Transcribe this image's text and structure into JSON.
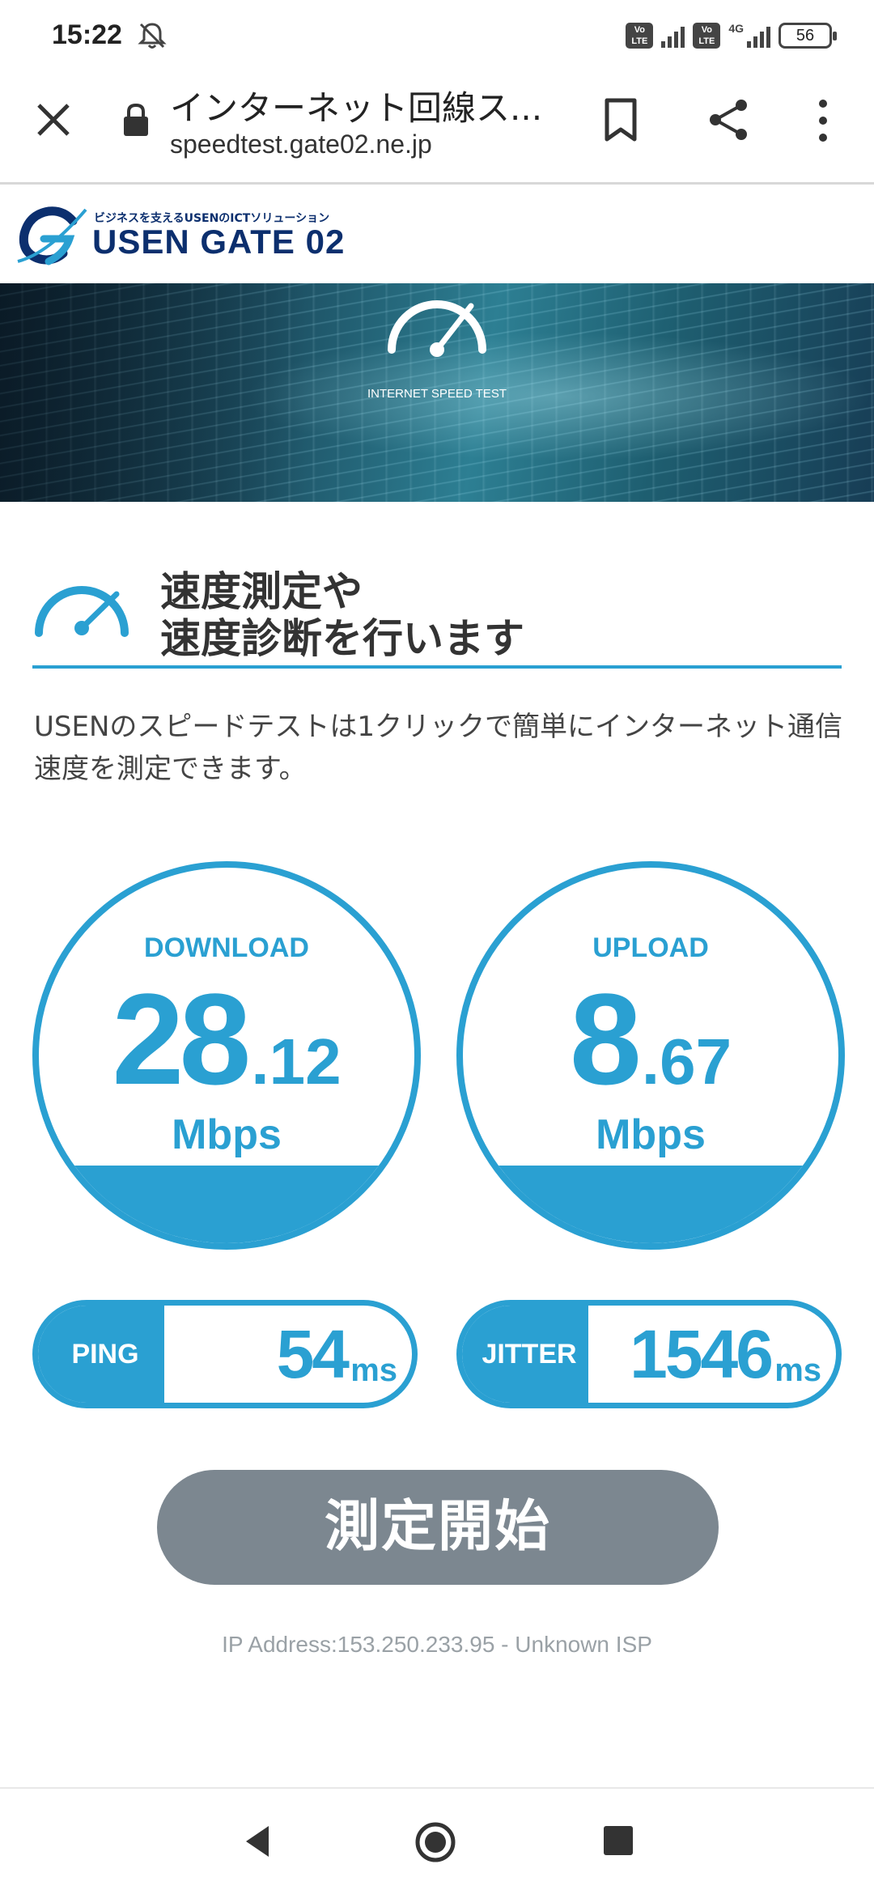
{
  "status_bar": {
    "time": "15:22",
    "battery": "56",
    "network_label": "4G",
    "volte_label": "Vo\nLTE",
    "icons": [
      "bell-off-icon",
      "signal-icon",
      "battery-icon"
    ]
  },
  "browser": {
    "title": "インターネット回線ス...",
    "url": "speedtest.gate02.ne.jp",
    "icons": [
      "close-icon",
      "lock-icon",
      "bookmark-icon",
      "share-icon",
      "more-icon"
    ]
  },
  "header": {
    "tagline": "ビジネスを支えるUSENのICTソリューション",
    "brand": "USEN GATE 02"
  },
  "hero": {
    "label": "INTERNET SPEED TEST"
  },
  "section": {
    "title_line1": "速度測定や",
    "title_line2": "速度診断を行います",
    "description": "USENのスピードテストは1クリックで簡単にインターネット通信速度を測定できます。"
  },
  "results": {
    "download": {
      "label": "DOWNLOAD",
      "int": "28",
      "dec": ".12",
      "unit": "Mbps"
    },
    "upload": {
      "label": "UPLOAD",
      "int": "8",
      "dec": ".67",
      "unit": "Mbps"
    },
    "ping": {
      "label": "PING",
      "value": "54",
      "unit": "ms"
    },
    "jitter": {
      "label": "JITTER",
      "value": "1546",
      "unit": "ms"
    }
  },
  "start_button": "測定開始",
  "ip_info": "IP Address:153.250.233.95 - Unknown ISP",
  "colors": {
    "accent": "#2aa0d2",
    "brand": "#0c2f6e",
    "button": "#7c8790"
  }
}
